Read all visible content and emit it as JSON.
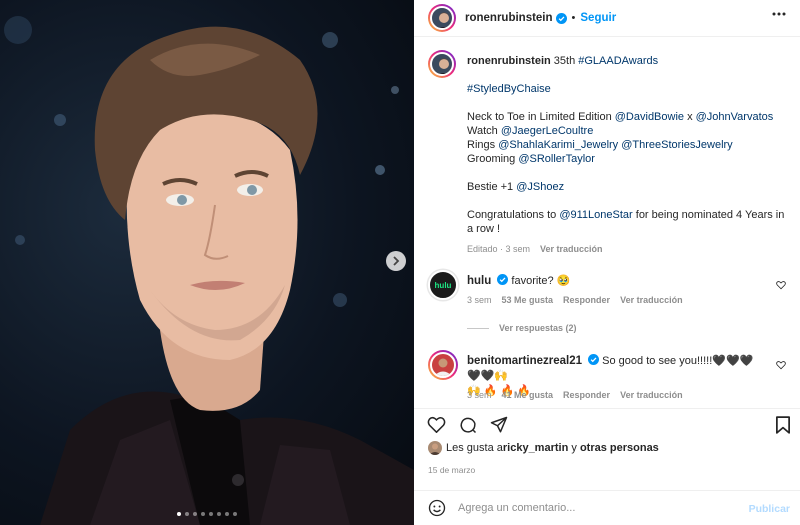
{
  "post": {
    "image_alt": "Retrato de ronenrubinstein",
    "carousel": {
      "count": 8,
      "active_index": 0
    }
  },
  "header": {
    "username": "ronenrubinstein",
    "separator": "•",
    "follow_label": "Seguir"
  },
  "caption": {
    "username": "ronenrubinstein",
    "lines": [
      [
        {
          "t": "35th "
        },
        {
          "t": "#GLAADAwards",
          "link": true
        }
      ],
      [],
      [
        {
          "t": "#StyledByChaise",
          "link": true
        }
      ],
      [],
      [
        {
          "t": "Neck to Toe in Limited Edition "
        },
        {
          "t": "@DavidBowie",
          "link": true
        },
        {
          "t": " x "
        },
        {
          "t": "@JohnVarvatos",
          "link": true
        }
      ],
      [
        {
          "t": "Watch "
        },
        {
          "t": "@JaegerLeCoultre",
          "link": true
        }
      ],
      [
        {
          "t": "Rings "
        },
        {
          "t": "@ShahlaKarimi_Jewelry",
          "link": true
        },
        {
          "t": " "
        },
        {
          "t": "@ThreeStoriesJewelry",
          "link": true
        }
      ],
      [
        {
          "t": "Grooming "
        },
        {
          "t": "@SRollerTaylor",
          "link": true
        }
      ],
      [],
      [
        {
          "t": "Bestie +1 "
        },
        {
          "t": "@JShoez",
          "link": true
        }
      ],
      [],
      [
        {
          "t": "Congratulations to "
        },
        {
          "t": "@911LoneStar",
          "link": true
        },
        {
          "t": " for being nominated 4 Years in"
        }
      ],
      [
        {
          "t": "a row !"
        }
      ]
    ],
    "edited": "Editado · 3 sem",
    "see_translation": "Ver traducción"
  },
  "comments": [
    {
      "username": "hulu",
      "text": "favorite? 🥹",
      "age": "3 sem",
      "likes": "53 Me gusta",
      "reply": "Responder",
      "translate": "Ver traducción",
      "replies": "Ver respuestas (2)"
    },
    {
      "username": "benitomartinezreal21",
      "text": "So good to see you!!!!!🖤🖤🖤🖤🖤🙌",
      "text2": "🙌 🔥 🔥 🔥",
      "age": "3 sem",
      "likes": "41 Me gusta",
      "reply": "Responder",
      "translate": "Ver traducción"
    }
  ],
  "likes": {
    "prefix": "Les gusta a ",
    "user": "ricky_martin",
    "middle": " y ",
    "others": "otras personas"
  },
  "date": "15 de marzo",
  "composer": {
    "placeholder": "Agrega un comentario...",
    "publish_label": "Publicar"
  },
  "colors": {
    "accent": "#0095f6",
    "link": "#00376b",
    "muted": "#8e8e8e",
    "hulu": "#1ce783"
  }
}
